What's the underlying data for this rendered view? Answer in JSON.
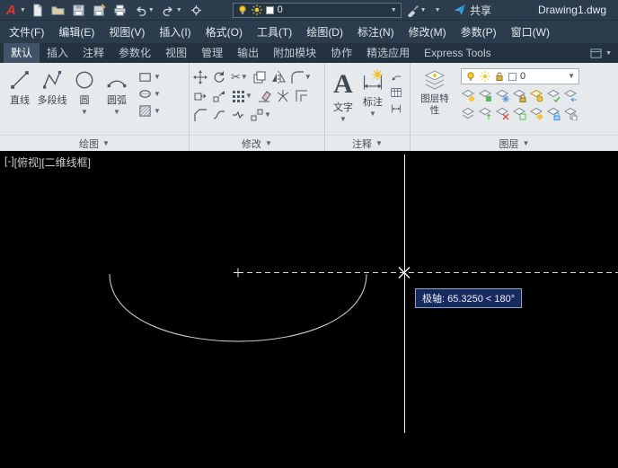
{
  "titlebar": {
    "doc_title": "Drawing1.dwg",
    "share_label": "共享",
    "layer_combo_value": "0"
  },
  "menubar": {
    "items": [
      "文件(F)",
      "编辑(E)",
      "视图(V)",
      "插入(I)",
      "格式(O)",
      "工具(T)",
      "绘图(D)",
      "标注(N)",
      "修改(M)",
      "参数(P)",
      "窗口(W)"
    ]
  },
  "ribbon": {
    "tabs": [
      "默认",
      "插入",
      "注释",
      "参数化",
      "视图",
      "管理",
      "输出",
      "附加模块",
      "协作",
      "精选应用",
      "Express Tools"
    ],
    "draw_panel": {
      "label": "绘图",
      "tools": [
        "直线",
        "多段线",
        "圆",
        "圆弧"
      ]
    },
    "modify_panel": {
      "label": "修改"
    },
    "annotate_panel": {
      "label": "注释",
      "text_tool": "文字",
      "dim_tool": "标注"
    },
    "layer_panel": {
      "label": "图层",
      "properties_button": "图层特性",
      "current_layer": "0"
    }
  },
  "viewport": {
    "controls": [
      "[-]",
      "[俯视]",
      "[二维线框]"
    ],
    "polar_tooltip": "极轴: 65.3250 < 180°"
  },
  "icons": {
    "text_glyph": "A",
    "autocad_logo": "red italic A with dropdown caret",
    "new_file_icon": "blank sheet",
    "open_folder_icon": "folder",
    "save_icon": "floppy disk",
    "save_as_icon": "floppy disk with plus",
    "print_icon": "printer",
    "undo_icon": "curved left arrow",
    "redo_icon": "curved right arrow",
    "share_icon": "blue paper plane",
    "bulb_icon": "yellow light bulb",
    "sun_icon": "yellow sun",
    "color_swatch": "white square",
    "trim_icon": "scissors",
    "layer_stack_icon": "stacked layer sheets"
  },
  "colors": {
    "titlebar_bg": "#2d3c4d",
    "ribbon_bg": "#e7eaed",
    "active_tab_bg": "#415366",
    "accent_yellow": "#f2c230",
    "share_blue": "#35aae0",
    "tooltip_bg": "#172a5e",
    "canvas_bg": "#000000",
    "entity_white": "#dcdcdc"
  }
}
